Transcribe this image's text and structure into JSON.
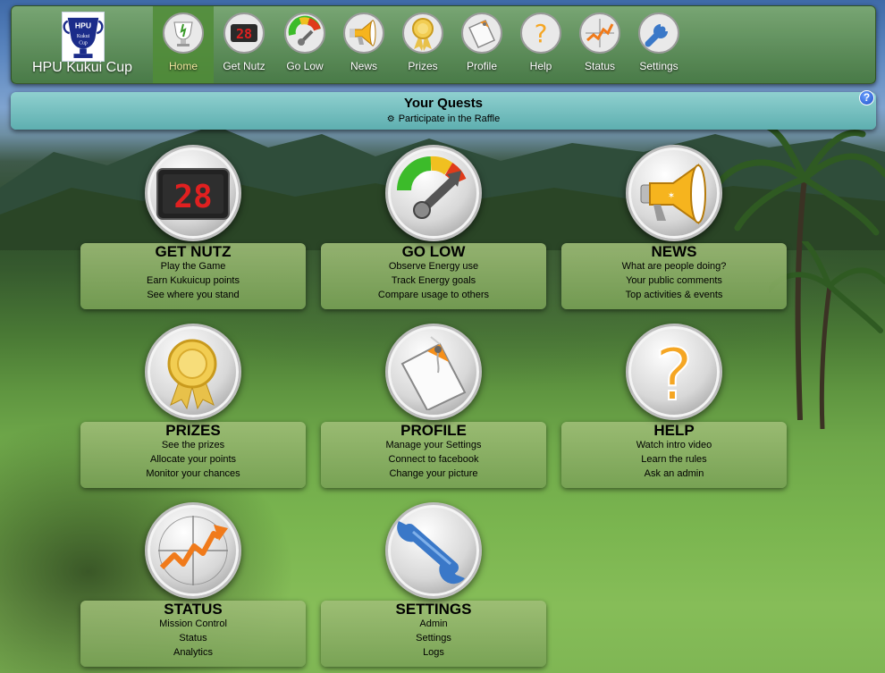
{
  "brand": {
    "name": "HPU Kukui Cup",
    "logo_text": "HPU Kukui Cup"
  },
  "nav": [
    {
      "label": "Home",
      "icon": "trophy-icon",
      "active": true
    },
    {
      "label": "Get Nutz",
      "icon": "scoreboard-icon",
      "active": false
    },
    {
      "label": "Go Low",
      "icon": "energy-gauge-icon",
      "active": false
    },
    {
      "label": "News",
      "icon": "megaphone-icon",
      "active": false
    },
    {
      "label": "Prizes",
      "icon": "ribbon-medal-icon",
      "active": false
    },
    {
      "label": "Profile",
      "icon": "id-tag-icon",
      "active": false
    },
    {
      "label": "Help",
      "icon": "question-mark-icon",
      "active": false
    },
    {
      "label": "Status",
      "icon": "chart-icon",
      "active": false
    },
    {
      "label": "Settings",
      "icon": "wrench-icon",
      "active": false
    }
  ],
  "quests": {
    "title": "Your Quests",
    "item": "Participate in the Raffle",
    "help": "?"
  },
  "tiles": [
    {
      "title": "GET NUTZ",
      "icon": "scoreboard-icon",
      "lines": [
        "Play the Game",
        "Earn Kukuicup points",
        "See where you stand"
      ]
    },
    {
      "title": "GO LOW",
      "icon": "energy-gauge-icon",
      "lines": [
        "Observe Energy use",
        "Track Energy goals",
        "Compare usage to others"
      ]
    },
    {
      "title": "NEWS",
      "icon": "megaphone-icon",
      "lines": [
        "What are people doing?",
        "Your public comments",
        "Top activities & events"
      ]
    },
    {
      "title": "PRIZES",
      "icon": "ribbon-medal-icon",
      "lines": [
        "See the prizes",
        "Allocate your points",
        "Monitor your chances"
      ]
    },
    {
      "title": "PROFILE",
      "icon": "id-tag-icon",
      "lines": [
        "Manage your Settings",
        "Connect to facebook",
        "Change your picture"
      ]
    },
    {
      "title": "HELP",
      "icon": "question-mark-icon",
      "lines": [
        "Watch intro video",
        "Learn the rules",
        "Ask an admin"
      ]
    },
    {
      "title": "STATUS",
      "icon": "chart-icon",
      "lines": [
        "Mission Control",
        "Status",
        "Analytics"
      ]
    },
    {
      "title": "SETTINGS",
      "icon": "wrench-icon",
      "lines": [
        "Admin",
        "Settings",
        "Logs"
      ]
    }
  ],
  "scoreboard_digits": "28",
  "colors": {
    "nav_bar": "#5f9a4e",
    "nav_active": "#508c37",
    "quests_bar": "#6fbdbd",
    "tile_card": "#9cb877",
    "help_blue": "#1e4fc8"
  }
}
